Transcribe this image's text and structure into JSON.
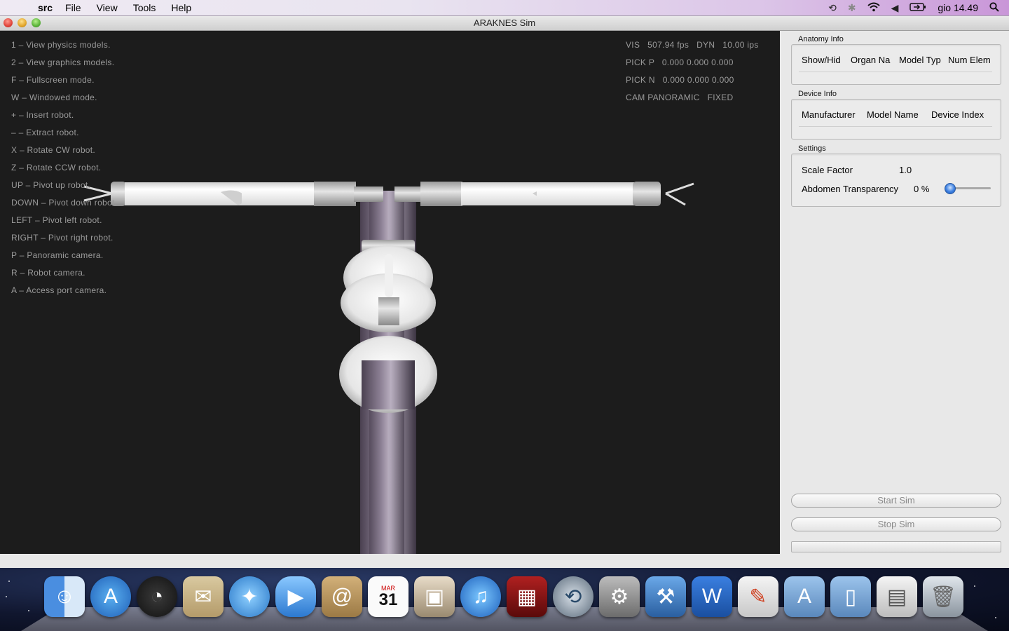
{
  "menubar": {
    "app_name": "src",
    "menus": [
      "File",
      "View",
      "Tools",
      "Help"
    ],
    "clock": "gio 14.49"
  },
  "window": {
    "title": "ARAKNES Sim"
  },
  "viewport": {
    "help_lines": [
      "1 – View physics models.",
      "2 – View graphics models.",
      "F – Fullscreen mode.",
      "W – Windowed mode.",
      "+ – Insert robot.",
      "– – Extract robot.",
      "X – Rotate CW robot.",
      "Z – Rotate CCW robot.",
      "UP – Pivot up robot.",
      "DOWN – Pivot down robot.",
      "LEFT – Pivot left robot.",
      "RIGHT – Pivot right robot.",
      "P – Panoramic camera.",
      "R – Robot camera.",
      "A – Access port camera."
    ],
    "stats": [
      "VIS   507.94 fps   DYN   10.00 ips",
      "PICK P   0.000 0.000 0.000",
      "PICK N   0.000 0.000 0.000",
      "CAM PANORAMIC   FIXED"
    ]
  },
  "panel": {
    "anatomy": {
      "title": "Anatomy Info",
      "columns": [
        "Show/Hid",
        "Organ Na",
        "Model Typ",
        "Num Elem"
      ]
    },
    "device": {
      "title": "Device Info",
      "columns": [
        "Manufacturer",
        "Model Name",
        "Device Index"
      ]
    },
    "settings": {
      "title": "Settings",
      "scale_label": "Scale Factor",
      "scale_value": "1.0",
      "transparency_label": "Abdomen Transparency",
      "transparency_value": "0 %",
      "transparency_level": 0
    },
    "start_button": "Start Sim",
    "stop_button": "Stop Sim"
  },
  "dock": {
    "apps": [
      "finder-icon",
      "app-store-icon",
      "dashboard-icon",
      "mail-icon",
      "safari-icon",
      "facetime-icon",
      "address-book-icon",
      "ical-icon",
      "iphoto-icon",
      "itunes-icon",
      "photo-booth-icon",
      "time-machine-icon",
      "system-preferences-icon",
      "xcode-icon",
      "word-icon",
      "script-editor-icon",
      "applications-folder-icon",
      "documents-folder-icon",
      "file-icon",
      "trash-icon"
    ],
    "ical_month": "MAR",
    "ical_day": "31"
  }
}
